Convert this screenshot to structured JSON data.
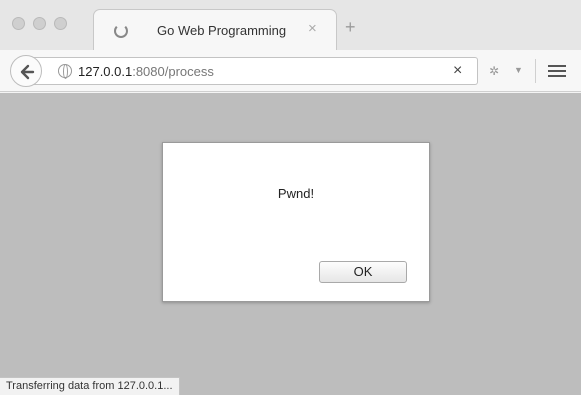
{
  "tab": {
    "title": "Go Web Programming",
    "close_glyph": "×"
  },
  "new_tab_glyph": "+",
  "address": {
    "host": "127.0.0.1",
    "rest": ":8080/process",
    "clear_glyph": "×"
  },
  "dialog": {
    "message": "Pwnd!",
    "ok_label": "OK"
  },
  "status_text": "Transferring data from 127.0.0.1...",
  "icons": [
    "back-arrow-icon",
    "globe-icon",
    "loading-spinner-icon",
    "extension-icon",
    "menu-icon"
  ]
}
